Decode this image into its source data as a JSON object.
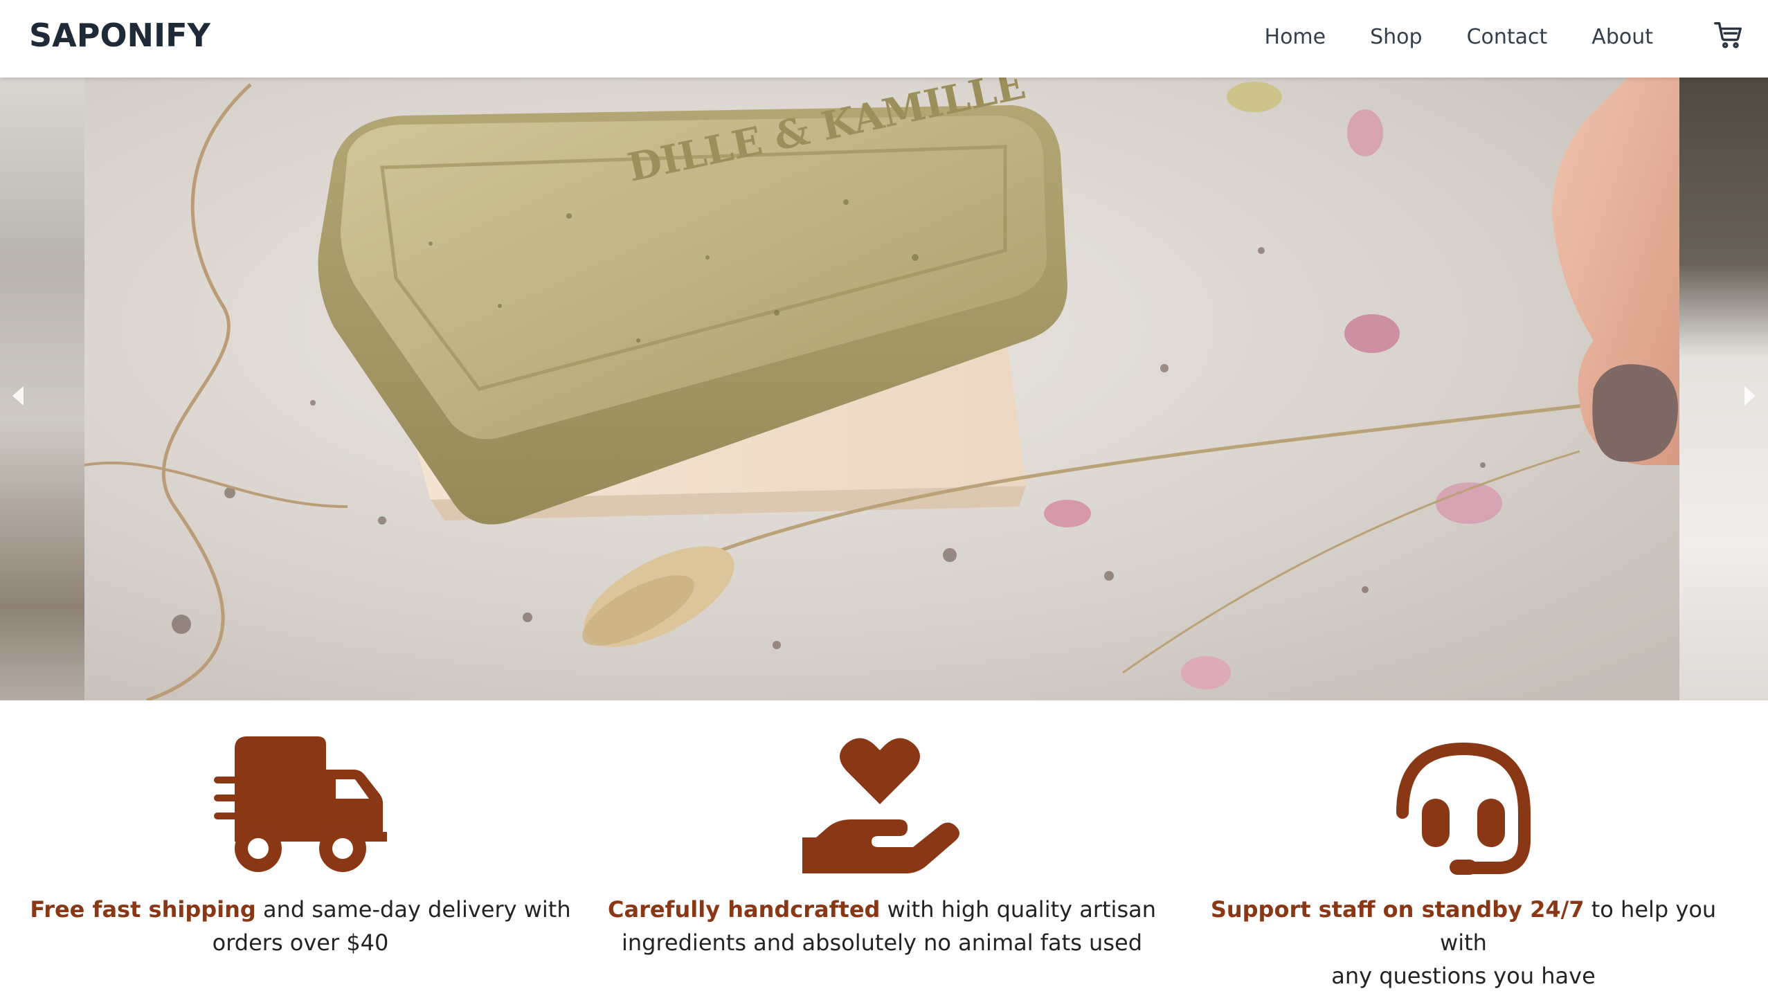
{
  "header": {
    "brand": "SAPONIFY",
    "nav": [
      {
        "label": "Home"
      },
      {
        "label": "Shop"
      },
      {
        "label": "Contact"
      },
      {
        "label": "About"
      }
    ],
    "cart_icon": "cart-icon"
  },
  "carousel": {
    "slide_count": 5,
    "active_index": 0,
    "soap_imprint": "DILLE & KAMILLE",
    "prev_icon": "chevron-left-icon",
    "next_icon": "chevron-right-icon"
  },
  "features": [
    {
      "icon": "truck-icon",
      "highlight": "Free fast shipping",
      "text_1": " and same-day delivery with",
      "text_2": "orders over $40"
    },
    {
      "icon": "hand-heart-icon",
      "highlight": "Carefully handcrafted",
      "text_1": " with high quality artisan",
      "text_2": "ingredients and absolutely no animal fats used"
    },
    {
      "icon": "headset-icon",
      "highlight": "Support staff on standby 24/7",
      "text_1": " to help you with",
      "text_2": "any questions you have"
    }
  ],
  "colors": {
    "accent": "#8a3716",
    "brand_text": "#1f2a38",
    "nav_text": "#33404c"
  }
}
